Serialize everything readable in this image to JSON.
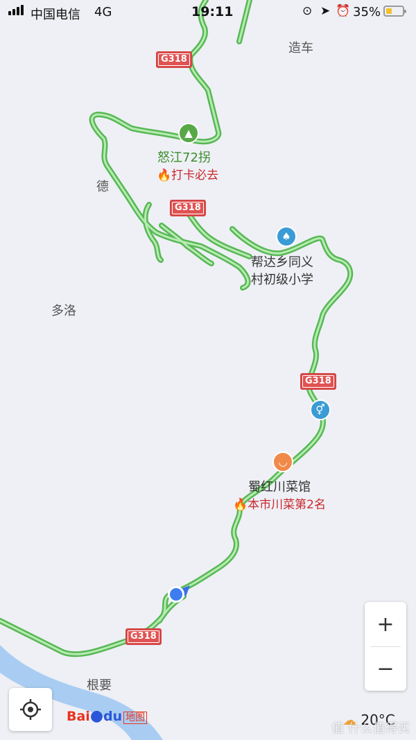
{
  "status_bar": {
    "carrier": "中国电信",
    "network": "4G",
    "time": "19:11",
    "battery_percent": "35%",
    "battery_level": 0.35
  },
  "map": {
    "place_labels": [
      {
        "id": "zaoche",
        "text": "造车"
      },
      {
        "id": "de",
        "text": "德"
      },
      {
        "id": "duoluo",
        "text": "多洛"
      },
      {
        "id": "genyao",
        "text": "根要"
      }
    ],
    "road_shield": "G318",
    "pois": {
      "nujiang": {
        "name": "怒江72拐",
        "tag": "打卡必去",
        "icon": "tree-icon",
        "color": "#58a847"
      },
      "school": {
        "name_line1": "帮达乡同义",
        "name_line2": "村初级小学",
        "icon": "school-icon",
        "color": "#3a9bd5"
      },
      "restaurant": {
        "name": "蜀红川菜馆",
        "tag": "本市川菜第2名",
        "icon": "bowl-icon",
        "color": "#f08a4b"
      },
      "toilet": {
        "icon": "toilet-icon",
        "color": "#3a9bd5"
      }
    },
    "road_color": "#7fd77b",
    "river_color": "#a9cdf2"
  },
  "controls": {
    "zoom_in": "+",
    "zoom_out": "−",
    "locate_icon": "locate-icon"
  },
  "branding": {
    "logo_bai": "Bai",
    "logo_du": "du",
    "logo_ditu": "地图"
  },
  "weather": {
    "temperature": "20°C",
    "icon": "cloud-sun-icon"
  },
  "watermark": "值 什么值得买"
}
